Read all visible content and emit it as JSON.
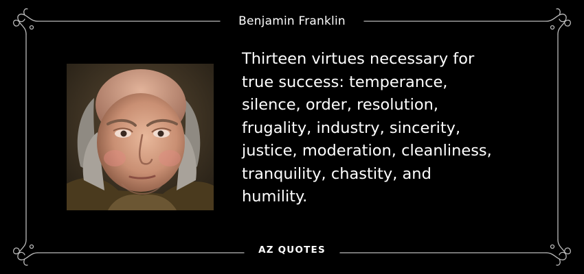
{
  "author": "Benjamin Franklin",
  "quote": {
    "lines": [
      "Thirteen virtues necessary for",
      "true success: temperance,",
      "silence, order, resolution,",
      "frugality, industry, sincerity,",
      "justice, moderation, cleanliness,",
      "tranquility, chastity, and",
      "humility."
    ]
  },
  "logo": "AZ QUOTES",
  "portrait": {
    "icon": "portrait-of-benjamin-franklin"
  },
  "colors": {
    "background": "#000000",
    "text": "#ffffff",
    "border": "#bdbdbd"
  }
}
